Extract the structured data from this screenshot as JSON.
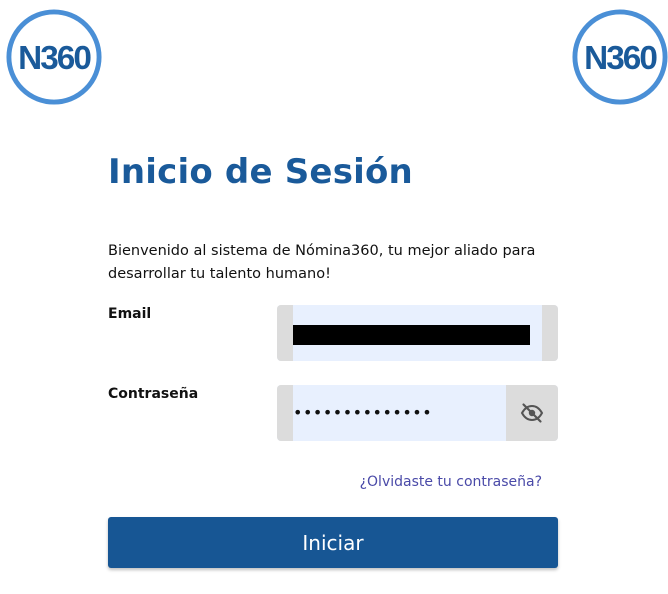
{
  "brand": {
    "logo_text": "N360",
    "logo_color": "#1a5a9a",
    "logo_ring_color": "#4a8fd6"
  },
  "login": {
    "title": "Inicio de Sesión",
    "welcome": "Bienvenido al sistema de Nómina360, tu mejor aliado para desarrollar tu talento humano!",
    "email_label": "Email",
    "email_value": "",
    "password_label": "Contraseña",
    "password_value": "••••••••••••••",
    "toggle_visibility_icon": "eye-off-icon",
    "forgot_link": "¿Olvidaste tu contraseña?",
    "submit_label": "Iniciar"
  },
  "colors": {
    "primary": "#175694",
    "input_bg": "#e8f0fe",
    "link": "#4a4aa8"
  }
}
